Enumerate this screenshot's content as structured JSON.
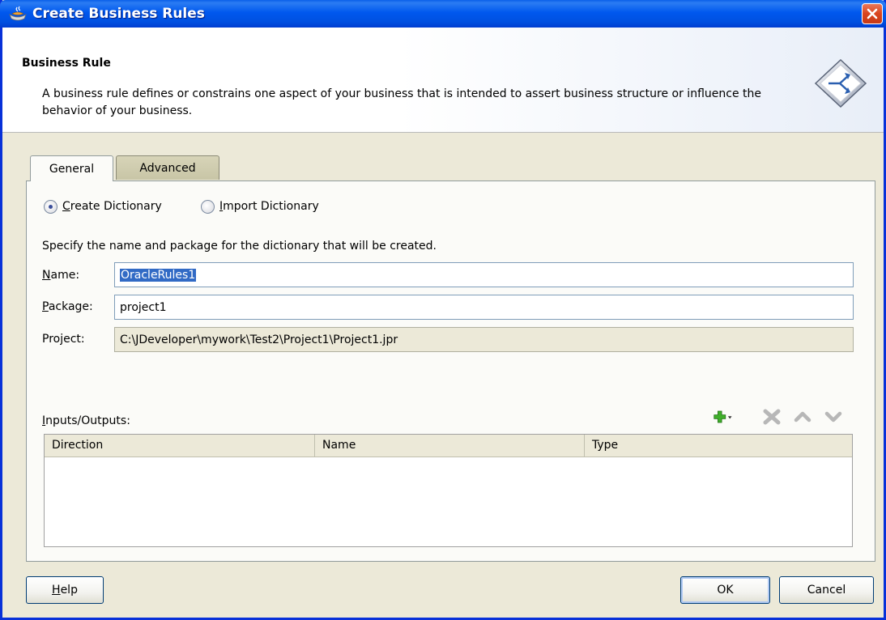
{
  "window": {
    "title": "Create Business Rules",
    "accent_color": "#0058ee"
  },
  "header": {
    "title": "Business Rule",
    "description": "A business rule defines or constrains one aspect of your business that is intended to assert business structure or influence the behavior of your business.",
    "logo_icon": "business-rule-diamond-icon"
  },
  "tabs": [
    {
      "label": "General",
      "selected": true
    },
    {
      "label": "Advanced",
      "selected": false
    }
  ],
  "dictionary_mode": {
    "options": [
      {
        "label_mnemonic": "C",
        "label_rest": "reate Dictionary",
        "checked": true
      },
      {
        "label_mnemonic": "I",
        "label_rest": "mport Dictionary",
        "checked": false
      }
    ]
  },
  "instruction": "Specify the name and package for the dictionary that will be created.",
  "fields": {
    "name": {
      "label_mnemonic": "N",
      "label_rest": "ame:",
      "value": "OracleRules1"
    },
    "package": {
      "label_mnemonic": "P",
      "label_rest": "ackage:",
      "value": "project1"
    },
    "project": {
      "label": "Project:",
      "value": "C:\\JDeveloper\\mywork\\Test2\\Project1\\Project1.jpr"
    }
  },
  "inputs_outputs": {
    "label_mnemonic": "I",
    "label_rest": "nputs/Outputs:",
    "toolbar": [
      "add-icon",
      "delete-icon",
      "move-up-icon",
      "move-down-icon"
    ],
    "columns": [
      "Direction",
      "Name",
      "Type"
    ],
    "rows": []
  },
  "buttons": {
    "help_mnemonic": "H",
    "help_rest": "elp",
    "ok": "OK",
    "cancel": "Cancel"
  }
}
